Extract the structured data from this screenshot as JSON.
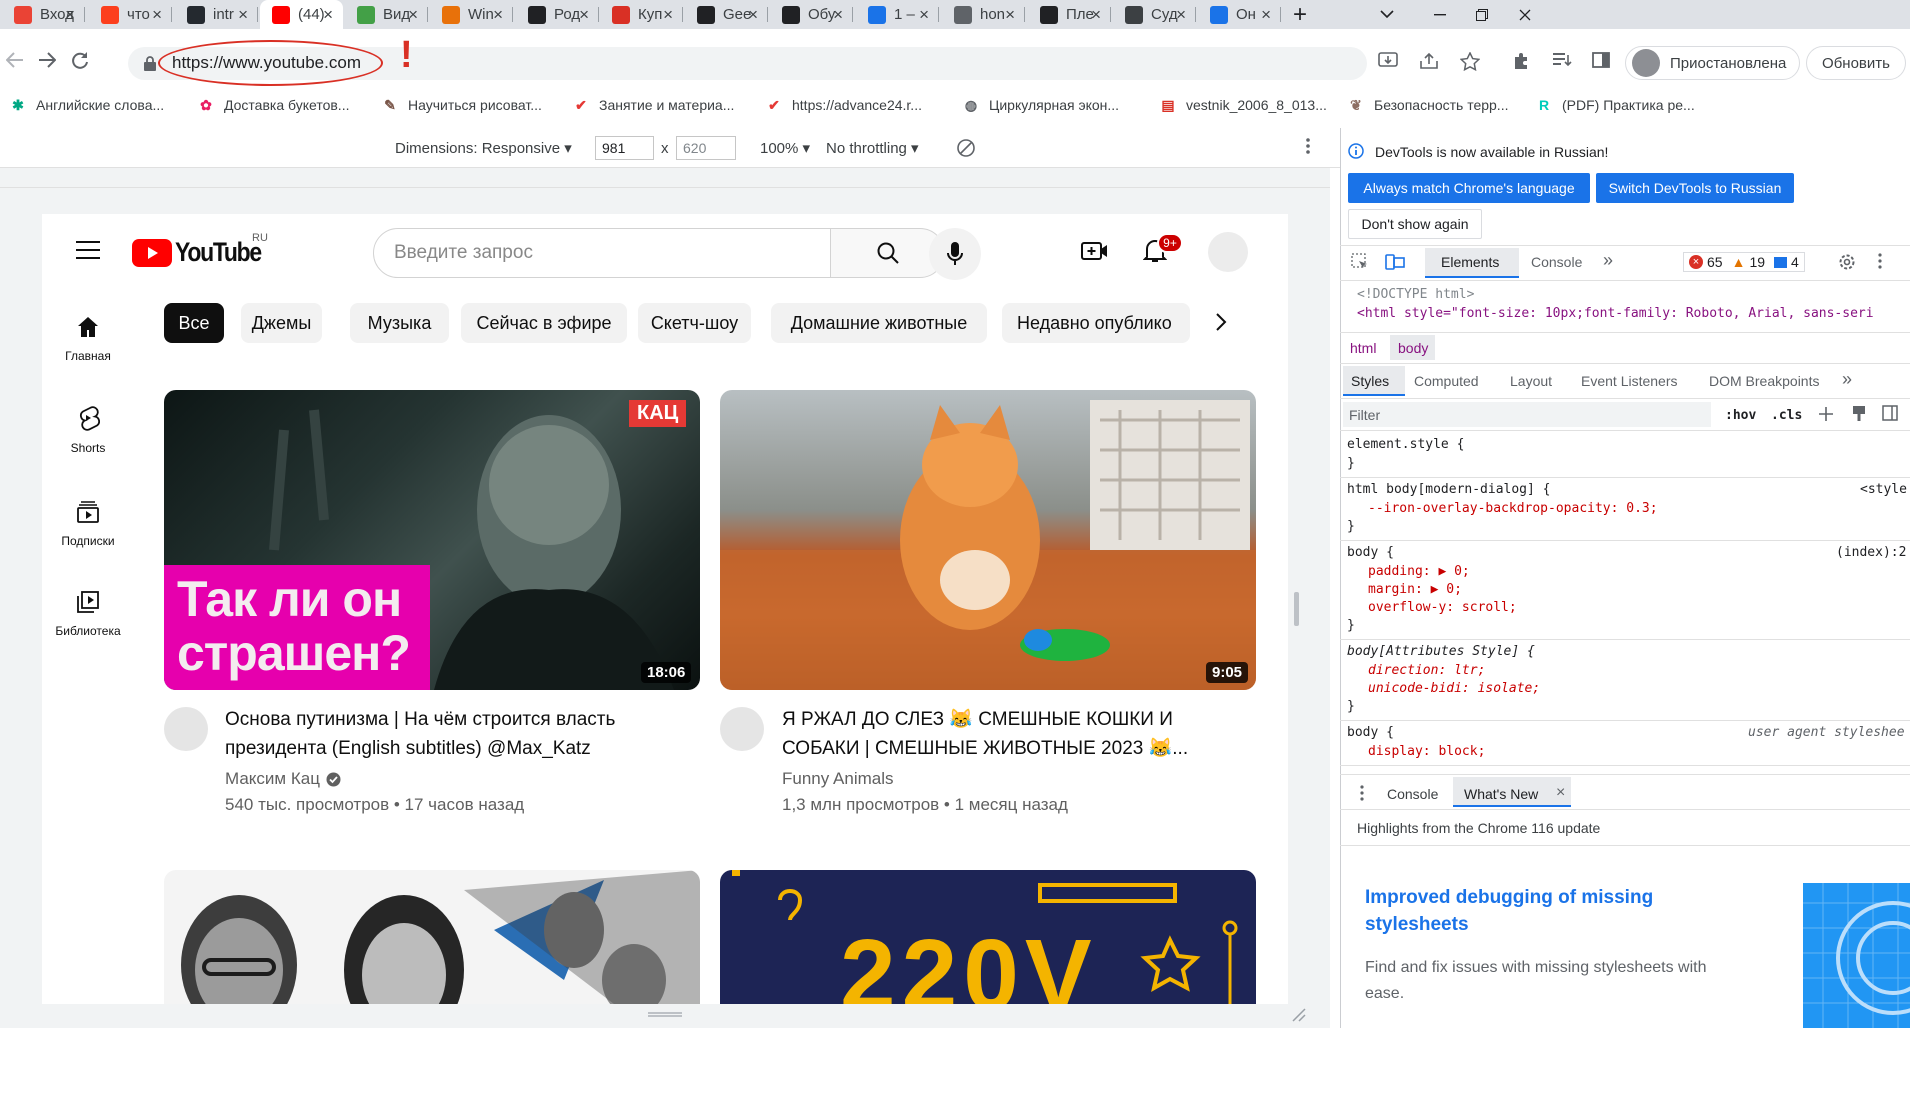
{
  "tabs": [
    {
      "label": "Вход",
      "icon": "gmail-icon",
      "color": "#ea4335"
    },
    {
      "label": "что",
      "icon": "yandex-icon",
      "color": "#fc3f1d"
    },
    {
      "label": "intr",
      "icon": "github-icon",
      "color": "#24292f"
    },
    {
      "label": "(44)",
      "icon": "youtube-icon",
      "color": "#ff0000",
      "active": true
    },
    {
      "label": "Вид",
      "icon": "hd-icon",
      "color": "#43a047"
    },
    {
      "label": "Win",
      "icon": "browser-window-icon",
      "color": "#e8710a"
    },
    {
      "label": "Род",
      "icon": "wikipedia-icon",
      "color": "#202124"
    },
    {
      "label": "Куп",
      "icon": "triangle-icon",
      "color": "#d93025"
    },
    {
      "label": "Gee",
      "icon": "chatgpt-icon",
      "color": "#202124"
    },
    {
      "label": "Обу",
      "icon": "chatgpt-icon",
      "color": "#202124"
    },
    {
      "label": "1 –",
      "icon": "wave-icon",
      "color": "#1a73e8"
    },
    {
      "label": "hon",
      "icon": "document-icon",
      "color": "#5f6368"
    },
    {
      "label": "Пле",
      "icon": "chatgpt-icon",
      "color": "#202124"
    },
    {
      "label": "Суд",
      "icon": "grid-icon",
      "color": "#3c4043"
    },
    {
      "label": "Он",
      "icon": "kotlin-icon",
      "color": "#1a73e8"
    }
  ],
  "browser": {
    "url": "https://www.youtube.com",
    "annotation_mark": "!",
    "profile_status": "Приостановлена",
    "update_label": "Обновить"
  },
  "bookmarks": [
    {
      "label": "Английские слова...",
      "icon": "puzzle-icon",
      "color": "#00a884"
    },
    {
      "label": "Доставка букетов...",
      "icon": "flower-icon",
      "color": "#e91e63"
    },
    {
      "label": "Научиться рисоват...",
      "icon": "pencil-icon",
      "color": "#795548"
    },
    {
      "label": "Занятие и материа...",
      "icon": "checkmark-icon",
      "color": "#e53935"
    },
    {
      "label": "https://advance24.r...",
      "icon": "checkmark-icon",
      "color": "#e53935"
    },
    {
      "label": "Циркулярная экон...",
      "icon": "globe-icon",
      "color": "#5f6368"
    },
    {
      "label": "vestnik_2006_8_013...",
      "icon": "pdf-icon",
      "color": "#d93025"
    },
    {
      "label": "Безопасность терр...",
      "icon": "leaf-icon",
      "color": "#8d6e63"
    },
    {
      "label": "(PDF) Практика ре...",
      "icon": "researchgate-icon",
      "color": "#00ccbb"
    }
  ],
  "device_toolbar": {
    "dimensions_label": "Dimensions: Responsive",
    "width": "981",
    "times": "x",
    "height": "620",
    "zoom": "100%",
    "throttling": "No throttling"
  },
  "youtube": {
    "logo_text": "YouTube",
    "region": "RU",
    "search_placeholder": "Введите запрос",
    "notifications_badge": "9+",
    "chips": [
      "Все",
      "Джемы",
      "Музыка",
      "Сейчас в эфире",
      "Скетч-шоу",
      "Домашние животные",
      "Недавно опублико"
    ],
    "sidebar": [
      {
        "label": "Главная",
        "icon": "home-icon"
      },
      {
        "label": "Shorts",
        "icon": "shorts-icon"
      },
      {
        "label": "Подписки",
        "icon": "subscriptions-icon"
      },
      {
        "label": "Библиотека",
        "icon": "library-icon"
      }
    ],
    "videos": [
      {
        "title_line1": "Основа путинизма | На чём строится власть",
        "title_line2": "президента (English subtitles) @Max_Katz",
        "channel": "Максим Кац",
        "verified": true,
        "meta": "540 тыс. просмотров • 17 часов назад",
        "duration": "18:06",
        "thumb_badge": "КАЦ",
        "thumb_text_line1": "Так ли он",
        "thumb_text_line2": "страшен?"
      },
      {
        "title_line1": "Я РЖАЛ ДО СЛЕЗ 😹 СМЕШНЫЕ КОШКИ И",
        "title_line2": "СОБАКИ | СМЕШНЫЕ ЖИВОТНЫЕ 2023 😹...",
        "channel": "Funny Animals",
        "meta": "1,3 млн просмотров • 1 месяц назад",
        "duration": "9:05"
      }
    ],
    "third_thumb_text": "220V"
  },
  "devtools": {
    "info_banner": "DevTools is now available in Russian!",
    "btn_match_language": "Always match Chrome's language",
    "btn_switch_russian": "Switch DevTools to Russian",
    "btn_dont_show": "Don't show again",
    "main_tabs": [
      "Elements",
      "Console"
    ],
    "errors": "65",
    "warnings": "19",
    "messages": "4",
    "dom_line1": "<!DOCTYPE html>",
    "dom_line2": "<html style=\"font-size: 10px;font-family: Roboto, Arial, sans-seri",
    "breadcrumb": [
      "html",
      "body"
    ],
    "sub_tabs": [
      "Styles",
      "Computed",
      "Layout",
      "Event Listeners",
      "DOM Breakpoints"
    ],
    "filter_placeholder": "Filter",
    "hov": ":hov",
    "cls": ".cls",
    "rules": [
      {
        "selector": "element.style {",
        "source": "",
        "decls": [],
        "close": "}"
      },
      {
        "selector": "html body[modern-dialog] {",
        "source": "<style",
        "decls": [
          "--iron-overlay-backdrop-opacity: 0.3;"
        ],
        "close": "}"
      },
      {
        "selector": "body {",
        "source": "(index):2",
        "decls": [
          "padding: ▶ 0;",
          "margin: ▶ 0;",
          "overflow-y: scroll;"
        ],
        "close": "}"
      },
      {
        "selector": "body[Attributes Style] {",
        "source": "",
        "decls": [
          "direction: ltr;",
          "unicode-bidi: isolate;"
        ],
        "close": "}"
      },
      {
        "selector": "body {",
        "source": "user agent styleshee",
        "decls": [
          "display: block;"
        ],
        "close": ""
      }
    ],
    "drawer_tabs": [
      "Console",
      "What's New"
    ],
    "whats_new_header": "Highlights from the Chrome 116 update",
    "whats_new_title_line1": "Improved debugging of missing",
    "whats_new_title_line2": "stylesheets",
    "whats_new_body_line1": "Find and fix issues with missing stylesheets with",
    "whats_new_body_line2": "ease."
  }
}
